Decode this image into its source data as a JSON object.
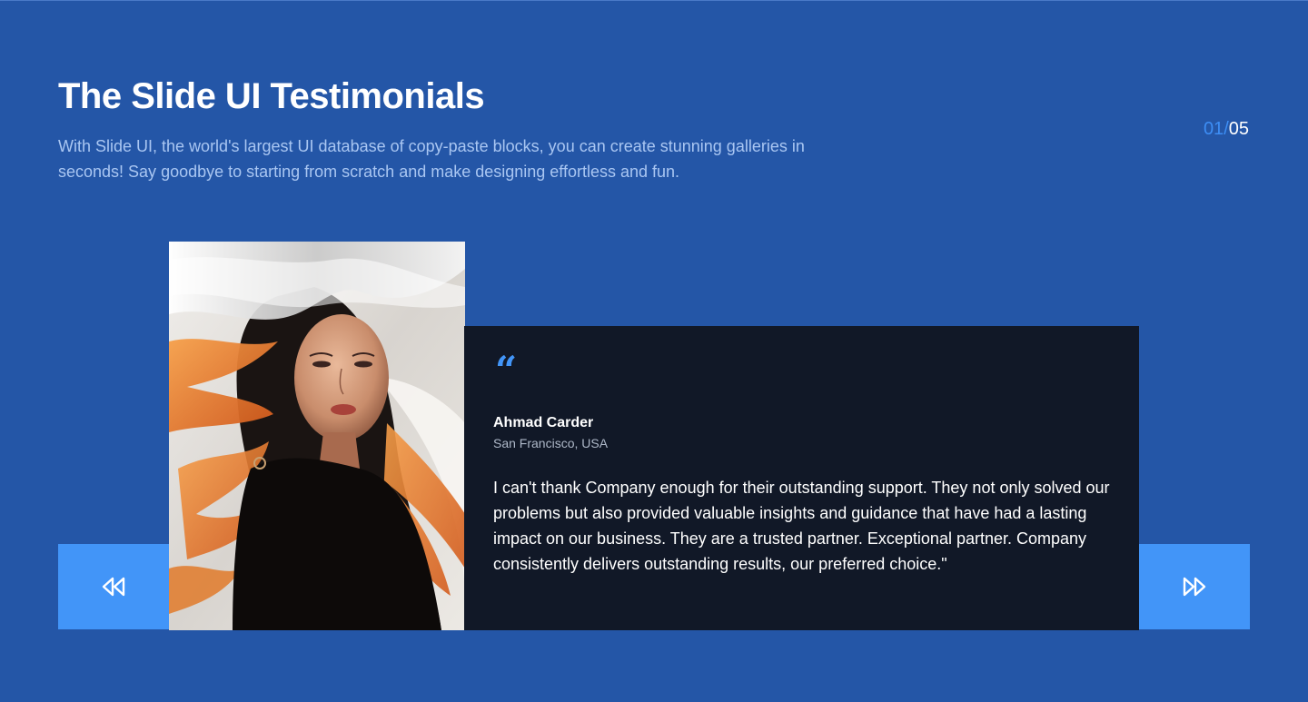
{
  "header": {
    "title": "The Slide UI Testimonials",
    "subtitle": "With Slide UI, the world's largest UI database of copy-paste blocks, you can create stunning galleries in seconds! Say goodbye to starting from scratch and make designing effortless and fun."
  },
  "pagination": {
    "current": "01",
    "separator": "/",
    "total": "05"
  },
  "controls": {
    "prev_icon": "rewind-icon",
    "next_icon": "fast-forward-icon"
  },
  "testimonial": {
    "quote_mark": "“",
    "name": "Ahmad Carder",
    "location": "San Francisco, USA",
    "text": "I can't thank Company enough for their outstanding support. They not only solved our problems but also provided valuable insights and guidance that have had a lasting impact on our business. They are a trusted partner. Exceptional partner. Company consistently delivers outstanding results, our preferred choice.\"",
    "image": "portrait-photo"
  },
  "colors": {
    "background": "#2456a7",
    "accent": "#4295f8",
    "card": "#111827"
  }
}
